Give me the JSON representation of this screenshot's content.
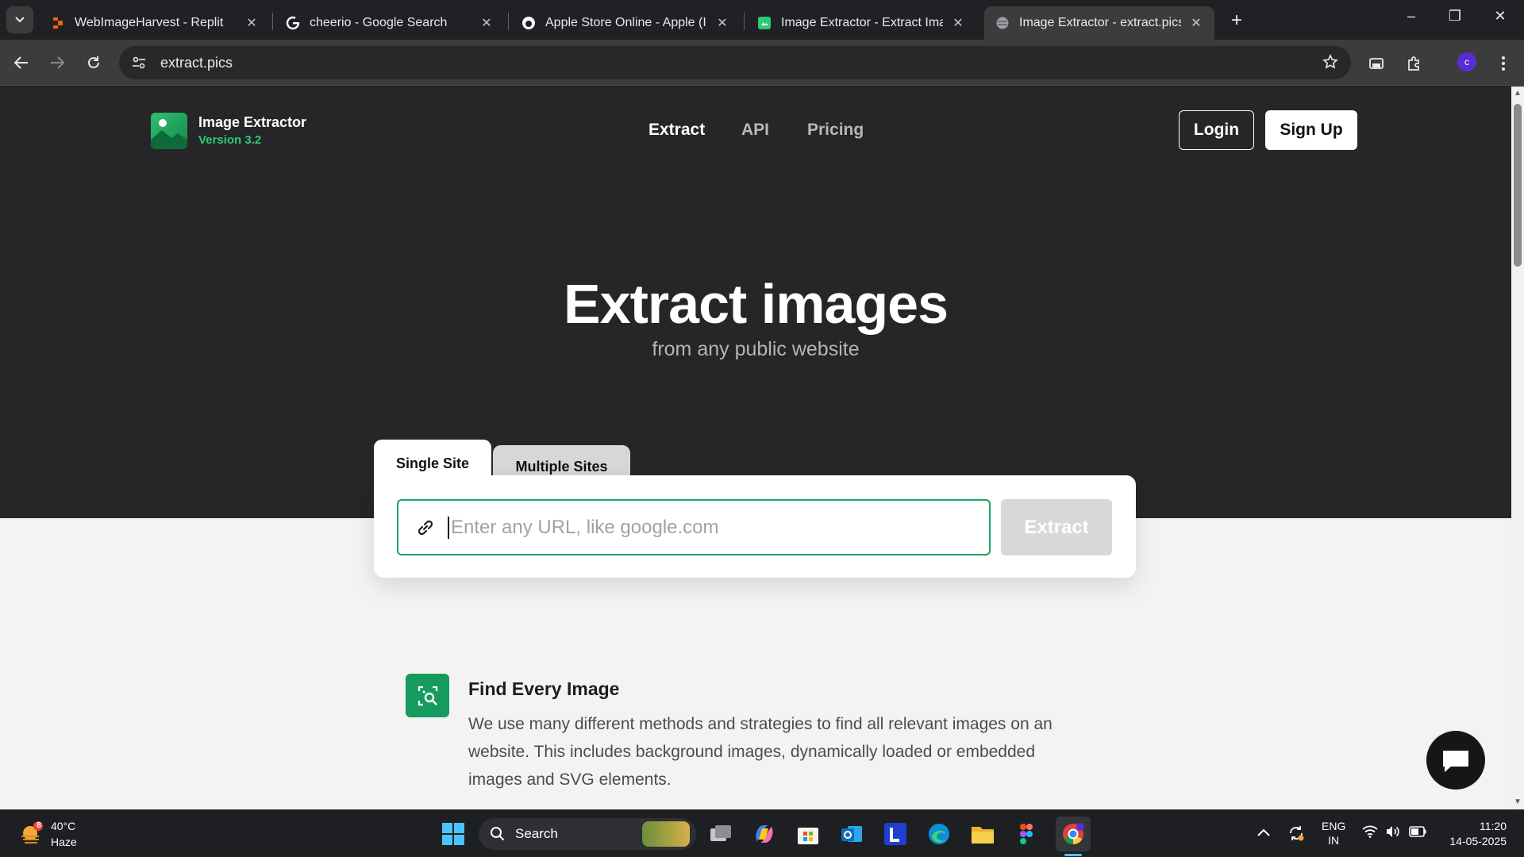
{
  "browser": {
    "tabs": [
      {
        "title": "WebImageHarvest - Replit",
        "favicon": "replit-icon",
        "active": false
      },
      {
        "title": "cheerio - Google Search",
        "favicon": "google-icon",
        "active": false
      },
      {
        "title": "Apple Store Online - Apple (IN)",
        "favicon": "apple-icon",
        "active": false
      },
      {
        "title": "Image Extractor - Extract Image",
        "favicon": "image-extractor-icon",
        "active": false
      },
      {
        "title": "Image Extractor - extract.pics",
        "favicon": "globe-icon",
        "active": true
      }
    ],
    "url": "extract.pics",
    "profile_initial": "c"
  },
  "site": {
    "brand_name": "Image Extractor",
    "brand_version": "Version 3.2",
    "nav": [
      {
        "label": "Extract",
        "active": true
      },
      {
        "label": "API",
        "active": false
      },
      {
        "label": "Pricing",
        "active": false
      }
    ],
    "login_label": "Login",
    "signup_label": "Sign Up",
    "hero_title": "Extract images",
    "hero_subtitle": "from any public website",
    "mode_tabs": [
      {
        "label": "Single Site",
        "active": true
      },
      {
        "label": "Multiple Sites",
        "active": false
      }
    ],
    "url_input": {
      "value": "",
      "placeholder": "Enter any URL, like google.com"
    },
    "extract_label": "Extract",
    "feature": {
      "title": "Find Every Image",
      "description": "We use many different methods and strategies to find all relevant images on an website. This includes background images, dynamically loaded or embedded images and SVG elements."
    },
    "colors": {
      "accent": "#1aa361",
      "hero_bg": "#262629",
      "brand_green": "#2ccb74"
    }
  },
  "taskbar": {
    "weather_temp": "40°C",
    "weather_cond": "Haze",
    "weather_badge": "8",
    "search_label": "Search",
    "lang_top": "ENG",
    "lang_bottom": "IN",
    "time": "11:20",
    "date": "14-05-2025"
  }
}
